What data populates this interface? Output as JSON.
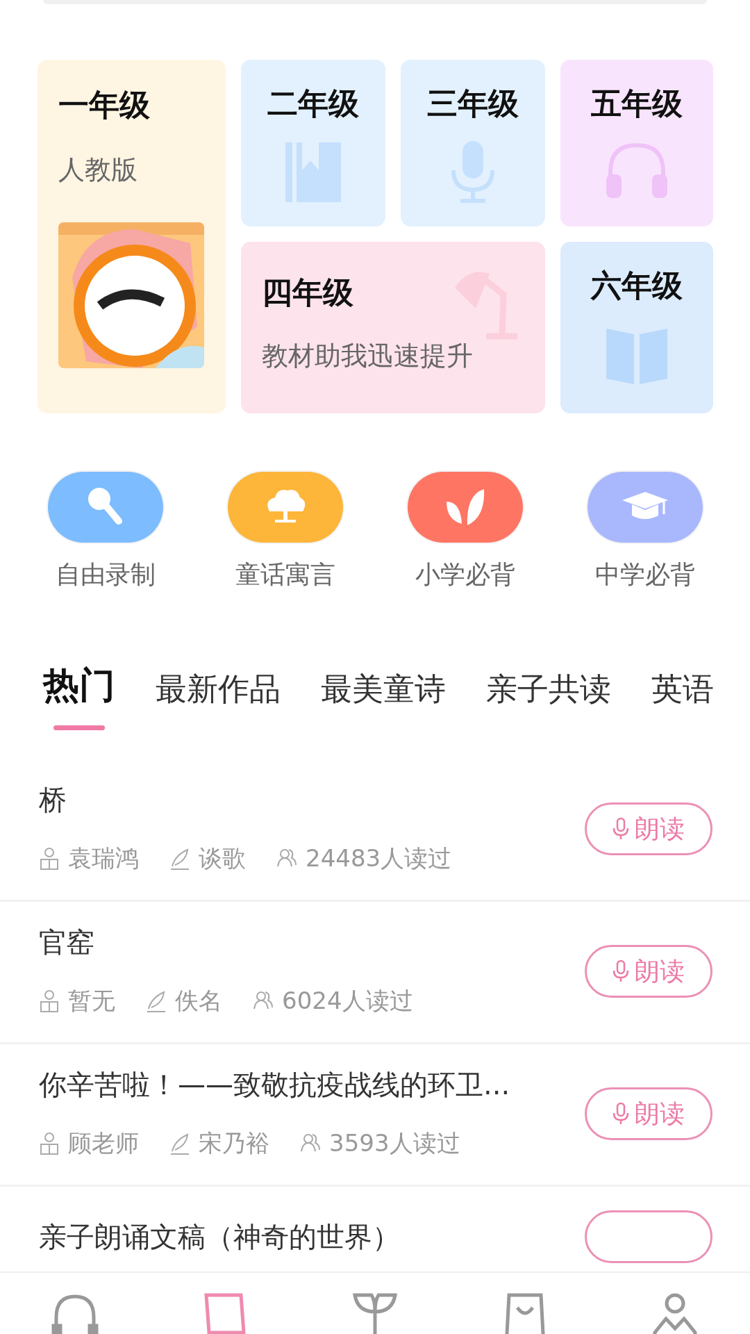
{
  "grades": [
    {
      "title": "一年级",
      "subtitle": "人教版",
      "kind": "tall",
      "color": "#fff5e3"
    },
    {
      "title": "二年级",
      "kind": "small",
      "color": "#e3f1fe"
    },
    {
      "title": "三年级",
      "kind": "small",
      "color": "#e3f1fe"
    },
    {
      "title": "五年级",
      "kind": "small",
      "color": "#f8e5fd"
    },
    {
      "title": "四年级",
      "subtitle": "教材助我迅速提升",
      "kind": "wide",
      "color": "#fde3ec"
    },
    {
      "title": "六年级",
      "kind": "small",
      "color": "#dcecfd"
    }
  ],
  "features": [
    {
      "label": "自由录制",
      "color": "#7dbcfe"
    },
    {
      "label": "童话寓言",
      "color": "#fdb53a"
    },
    {
      "label": "小学必背",
      "color": "#fe7564"
    },
    {
      "label": "中学必背",
      "color": "#a9b8fd"
    }
  ],
  "tabs": [
    {
      "label": "热门",
      "selected": true
    },
    {
      "label": "最新作品",
      "selected": false
    },
    {
      "label": "最美童诗",
      "selected": false
    },
    {
      "label": "亲子共读",
      "selected": false
    },
    {
      "label": "英语",
      "selected": false
    }
  ],
  "works": [
    {
      "title": "桥",
      "reader": "袁瑞鸿",
      "author": "谈歌",
      "reads": "24483人读过",
      "button": "朗读"
    },
    {
      "title": "官窑",
      "reader": "暂无",
      "author": "佚名",
      "reads": "6024人读过",
      "button": "朗读"
    },
    {
      "title": "你辛苦啦！——致敬抗疫战线的环卫...",
      "reader": "顾老师",
      "author": "宋乃裕",
      "reads": "3593人读过",
      "button": "朗读"
    },
    {
      "title": "亲子朗诵文稿（神奇的世界）"
    }
  ],
  "nav": [
    {
      "selected": false
    },
    {
      "selected": true
    },
    {
      "selected": false
    },
    {
      "selected": false
    },
    {
      "selected": false
    }
  ]
}
